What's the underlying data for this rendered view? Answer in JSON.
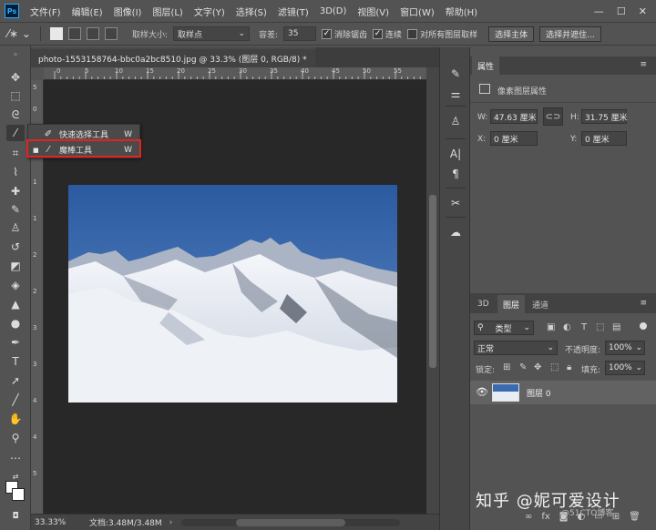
{
  "menubar": {
    "app_icon": "Ps",
    "items": [
      "文件(F)",
      "编辑(E)",
      "图像(I)",
      "图层(L)",
      "文字(Y)",
      "选择(S)",
      "滤镜(T)",
      "3D(D)",
      "视图(V)",
      "窗口(W)",
      "帮助(H)"
    ]
  },
  "options_bar": {
    "sample_size_label": "取样大小:",
    "sample_size_value": "取样点",
    "tolerance_label": "容差:",
    "tolerance_value": "35",
    "antialias_label": "消除锯齿",
    "antialias_checked": true,
    "contiguous_label": "连续",
    "contiguous_checked": true,
    "all_layers_label": "对所有图层取样",
    "all_layers_checked": false,
    "select_subject_label": "选择主体",
    "select_and_mask_label": "选择并遮住..."
  },
  "document": {
    "tab_title": "photo-1553158764-bbc0a2bc8510.jpg @ 33.3% (图层 0, RGB/8) *",
    "zoom": "33.33%",
    "doc_size": "文档:3.48M/3.48M",
    "ruler_top_ticks": [
      "0",
      "5",
      "10",
      "15",
      "20",
      "25",
      "30",
      "35",
      "40",
      "45",
      "50",
      "55"
    ],
    "ruler_left_ticks": [
      "5",
      "0",
      "5",
      "1",
      "1",
      "2",
      "2",
      "3",
      "3",
      "4",
      "4",
      "5"
    ]
  },
  "tool_flyout": {
    "items": [
      {
        "label": "快速选择工具",
        "shortcut": "W",
        "icon": "quick-selection-icon",
        "selected": false
      },
      {
        "label": "魔棒工具",
        "shortcut": "W",
        "icon": "magic-wand-icon",
        "selected": true
      }
    ]
  },
  "properties": {
    "tab_label": "属性",
    "section_label": "像素图层属性",
    "w_label": "W:",
    "w_value": "47.63 厘米",
    "h_label": "H:",
    "h_value": "31.75 厘米",
    "x_label": "X:",
    "x_value": "0 厘米",
    "y_label": "Y:",
    "y_value": "0 厘米"
  },
  "layers_panel": {
    "tabs": [
      "3D",
      "图层",
      "通道"
    ],
    "active_tab": "图层",
    "filter_label": "类型",
    "blend_mode": "正常",
    "opacity_label": "不透明度:",
    "opacity_value": "100%",
    "lock_label": "锁定:",
    "fill_label": "填充:",
    "fill_value": "100%",
    "layers": [
      {
        "name": "图层 0",
        "visible": true
      }
    ]
  },
  "watermark": {
    "text": "知乎 @妮可爱设计",
    "subtext": "@51CTO博客"
  },
  "colors": {
    "accent_highlight": "#e12323",
    "sky": "#3a6bb0",
    "snow": "#e8ecf3"
  }
}
